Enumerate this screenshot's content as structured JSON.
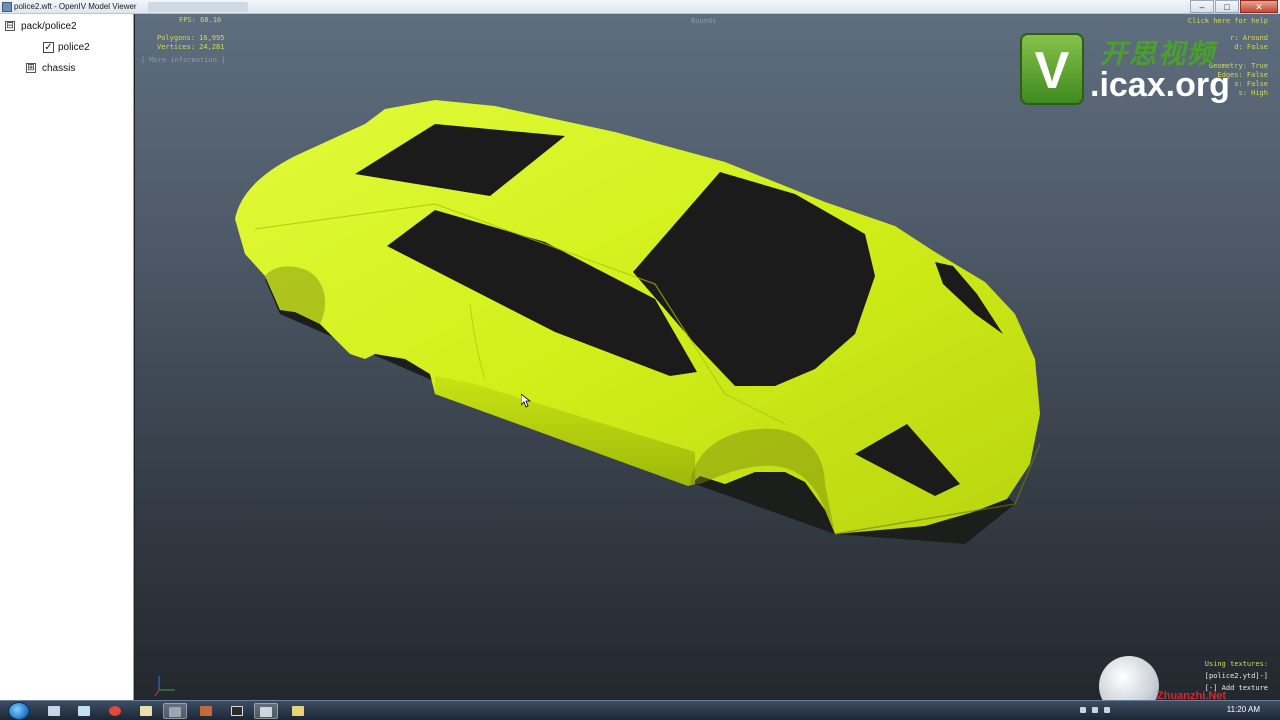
{
  "window": {
    "title": "police2.wft - OpenIV Model Viewer",
    "buttons": {
      "minimize": "–",
      "maximize": "□",
      "close": "✕"
    }
  },
  "tree": {
    "root": {
      "label": "pack/police2",
      "expander": "⊟"
    },
    "items": [
      {
        "label": "police2",
        "checked": "✓"
      },
      {
        "label": "chassis",
        "expander": "⊞"
      }
    ]
  },
  "viewport": {
    "hud_left": {
      "fps": "FPS: 68.10",
      "polygons": "Polygons: 16,995",
      "vertices": "Vertices: 24,281",
      "more_info": "[ More information ]"
    },
    "hud_top": {
      "bounds": "Bounds"
    },
    "hud_right": {
      "help": "Click here for help",
      "lines": [
        "r: Around",
        "d: False",
        "",
        "Geometry: True",
        "Edges: False",
        "s: False",
        "s: High"
      ]
    },
    "hud_bottom_right": {
      "using_textures": "Using textures:",
      "texture_item": "[police2.ytd]-]",
      "add_texture": "[-] Add texture"
    },
    "watermark": {
      "cn": "开思视频",
      "url": ".icax.org",
      "logo_letter": "V"
    },
    "corner_watermark": "Zhuanzhi.Net",
    "colors": {
      "car_body": "#d4f21c",
      "car_glass": "#1c1c1c",
      "bg_top": "#5e6e7e",
      "bg_bottom": "#23282e"
    }
  },
  "taskbar": {
    "clock": "11:20 AM",
    "icons": [
      "explorer-icon",
      "notepad-icon",
      "chrome-icon",
      "folder-icon",
      "settings-icon",
      "winrar-icon",
      "terminal-icon",
      "openiv-icon",
      "files-icon"
    ]
  }
}
